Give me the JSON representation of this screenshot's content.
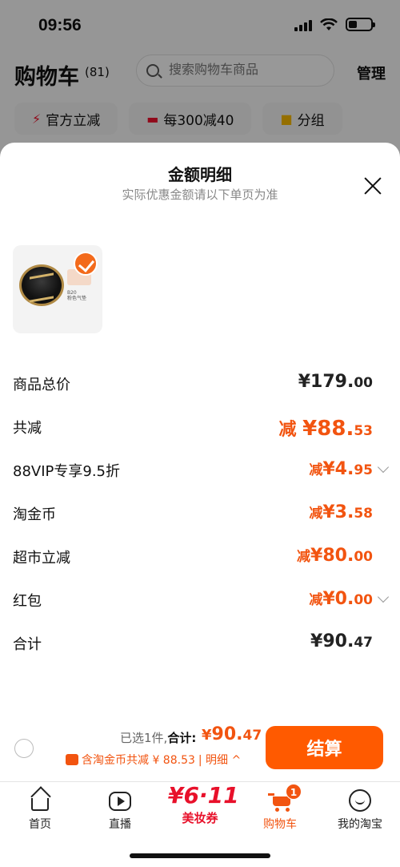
{
  "status_bar": {
    "time": "09:56"
  },
  "cart_header": {
    "title": "购物车",
    "count": "(81)",
    "search_placeholder": "搜索购物车商品",
    "manage_label": "管理"
  },
  "chips": [
    {
      "icon": "lightning-icon",
      "label": "官方立减"
    },
    {
      "icon": "ticket-icon",
      "label": "每300减40"
    },
    {
      "icon": "folder-icon",
      "label": "分组"
    }
  ],
  "sheet": {
    "title": "金额明细",
    "subtitle": "实际优惠金额请以下单页为准",
    "product": {
      "thumb_text": "B20",
      "thumb_sub": "粉色气垫"
    },
    "rows": [
      {
        "label": "商品总价",
        "prefix": "",
        "int": "¥179.",
        "dec": "00",
        "style": "black",
        "chevron": false
      },
      {
        "label": "共减",
        "prefix": "减 ",
        "int": "¥88.",
        "dec": "53",
        "style": "orange big",
        "chevron": false
      },
      {
        "label": "88VIP专享9.5折",
        "prefix": "减",
        "int": "¥4.",
        "dec": "95",
        "style": "orange",
        "chevron": true
      },
      {
        "label": "淘金币",
        "prefix": "减",
        "int": "¥3.",
        "dec": "58",
        "style": "orange",
        "chevron": false
      },
      {
        "label": "超市立减",
        "prefix": "减",
        "int": "¥80.",
        "dec": "00",
        "style": "orange",
        "chevron": false
      },
      {
        "label": "红包",
        "prefix": "减",
        "int": "¥0.",
        "dec": "00",
        "style": "orange",
        "chevron": true
      },
      {
        "label": "合计",
        "prefix": "",
        "int": "¥90.",
        "dec": "47",
        "style": "black",
        "chevron": false
      }
    ]
  },
  "checkout": {
    "selected_text": "已选1件,",
    "total_label": "合计:",
    "total_yen": "¥",
    "total_int": "90.",
    "total_dec": "47",
    "coin_text": "含淘金币共减 ¥ 88.53",
    "detail_label": "| 明细 ^",
    "settle_label": "结算"
  },
  "tabbar": {
    "home": "首页",
    "live": "直播",
    "promo_num": "¥6·11",
    "promo_label": "美妆券",
    "cart": "购物车",
    "cart_badge": "1",
    "me": "我的淘宝"
  },
  "colors": {
    "accent": "#f25410",
    "button": "#ff5a00",
    "promo": "#e8102a"
  }
}
